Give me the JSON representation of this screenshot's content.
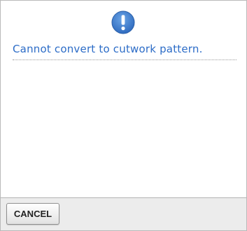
{
  "dialog": {
    "icon": "exclamation-icon",
    "icon_color": "#3a78c9",
    "message": "Cannot convert to cutwork pattern.",
    "message_color": "#2c6cc7"
  },
  "footer": {
    "cancel_label": "CANCEL"
  }
}
